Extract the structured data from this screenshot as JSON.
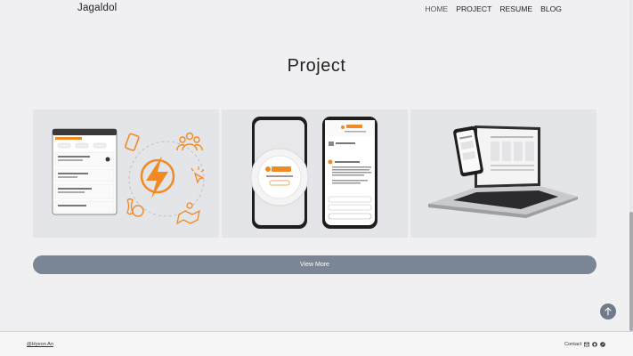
{
  "brand": "Jagaldol",
  "nav": [
    {
      "label": "HOME",
      "active": true
    },
    {
      "label": "PROJECT",
      "active": false
    },
    {
      "label": "RESUME",
      "active": false
    },
    {
      "label": "BLOG",
      "active": false
    }
  ],
  "section_title": "Project",
  "projects": [
    {
      "image": "bowling-app-screenshot",
      "accent": "#f08a24"
    },
    {
      "image": "chatfoodie-mobile-screens",
      "accent": "#f08a24",
      "logo_text": "ChatFoodie"
    },
    {
      "image": "laptop-and-phone-mockup",
      "accent": "#2b2b2b"
    }
  ],
  "view_more_label": "View More",
  "scroll_top_icon": "arrow-up-icon",
  "footer": {
    "copyright": "@Hyeon An",
    "contact_label": "Contact",
    "contact_icons": [
      "mail-icon",
      "github-icon",
      "blog-icon"
    ]
  },
  "colors": {
    "background": "#f0f0f2",
    "card": "#e4e5e9",
    "button": "#7a8696",
    "accent": "#f08a24"
  }
}
